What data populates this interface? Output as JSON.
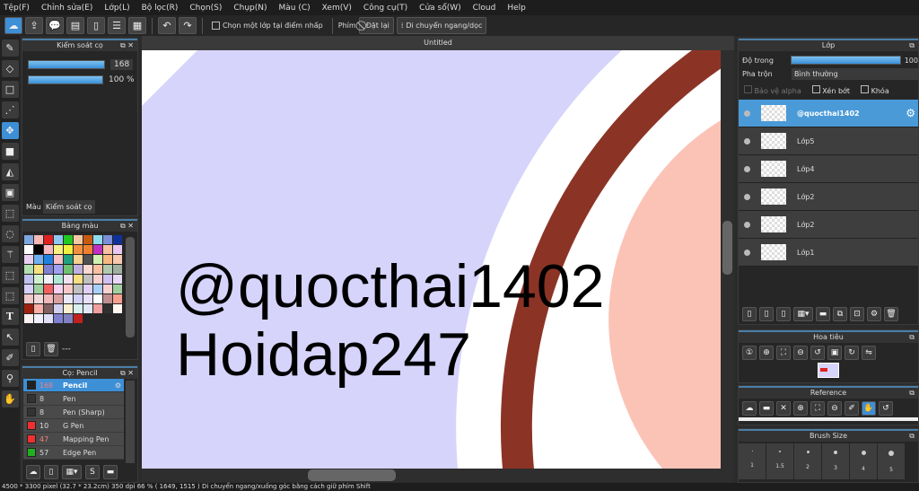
{
  "menu": [
    "Tệp(F)",
    "Chỉnh sửa(E)",
    "Lớp(L)",
    "Bộ lọc(R)",
    "Chọn(S)",
    "Chụp(N)",
    "Màu (C)",
    "Xem(V)",
    "Công cụ(T)",
    "Cửa sổ(W)",
    "Cloud",
    "Help"
  ],
  "toolbar": {
    "select_layer": "Chọn một lớp tại điểm nhấp",
    "key_label": "Phím",
    "reset": "Đặt lại",
    "move": "Di chuyển ngang/dọc"
  },
  "brush_control": {
    "title": "Kiểm soát cọ",
    "size": "168",
    "opacity": "100 %",
    "tab_color": "Màu",
    "tab_brush": "Kiểm soát cọ"
  },
  "palette": {
    "title": "Bảng màu",
    "label": "---",
    "colors": [
      "#7ea6e0",
      "#f7b8b8",
      "#e02020",
      "#8ec8f0",
      "#20c820",
      "#f6c8a8",
      "#c85a10",
      "#8fdcf0",
      "#7c8ed8",
      "#10309a",
      "#ffffff",
      "#000000",
      "#f7b8c0",
      "#f8f080",
      "#f0f040",
      "#f09040",
      "#f08030",
      "#c030c0",
      "#f4c0a0",
      "#e8c8f0",
      "#e8d0f0",
      "#70b0f0",
      "#2080e0",
      "#f8c0c8",
      "#20a080",
      "#f8d090",
      "#505050",
      "#d0f0b0",
      "#f8b880",
      "#f8c8b0",
      "#b0e0b0",
      "#f8e080",
      "#8080d0",
      "#a0a0f0",
      "#70c070",
      "#c0b0e0",
      "#f8d8d0",
      "#f8c0a0",
      "#b0c8b0",
      "#a0b0a0",
      "#c0c0f0",
      "#d0f0d0",
      "#f0f0f8",
      "#b0e8d8",
      "#f0e0f0",
      "#f8e080",
      "#c0c0c0",
      "#f8d0d0",
      "#d0c0f0",
      "#e8d8f8",
      "#d8d0f8",
      "#a0d0a0",
      "#f06060",
      "#f8d0f0",
      "#f8c8c8",
      "#c0c0c0",
      "#e0d0f8",
      "#a8d0f8",
      "#f8d0d0",
      "#a0d0a0",
      "#f0c8c8",
      "#f0d8d8",
      "#f0b8b8",
      "#d8a0a0",
      "#e8e8f8",
      "#d0d0f8",
      "#e8e0f8",
      "#ffffff",
      "#c09090",
      "#f8a090",
      "#a02010",
      "#f8b0a8",
      "#806060",
      "#d0d0f0",
      "#f8f0d0",
      "#d8f0f0",
      "#e0e8f8",
      "#f0a0a0",
      "#303030",
      "#fff8f0",
      "#fff0f0",
      "#f0f0ff",
      "#e0e0f8",
      "#8080d0",
      "#8080c0",
      "#c02020"
    ]
  },
  "brushes": {
    "title": "Cọ: Pencil",
    "items": [
      {
        "size": "168",
        "name": "Pencil",
        "color": "#222222"
      },
      {
        "size": "8",
        "name": "Pen",
        "color": "#333333"
      },
      {
        "size": "8",
        "name": "Pen (Sharp)",
        "color": "#333333"
      },
      {
        "size": "10",
        "name": "G Pen",
        "color": "#f03030"
      },
      {
        "size": "47",
        "name": "Mapping Pen",
        "color": "#f03030"
      },
      {
        "size": "57",
        "name": "Edge Pen",
        "color": "#20b020"
      }
    ]
  },
  "canvas": {
    "tab": "Untitled",
    "text1": "@quocthai1402",
    "text2": "Hoidap247"
  },
  "status": "4500 * 3300 pixel  (32.7 * 23.2cm)  350 dpi  66 %  ( 1649, 1515 )  Di chuyển ngang/xuống góc bằng cách giữ phím Shift",
  "layers": {
    "title": "Lớp",
    "opacity_label": "Độ trong",
    "opacity": "100",
    "blend_label": "Pha trộn",
    "blend": "Bình thường",
    "protect_alpha": "Bảo vệ alpha",
    "clip": "Xén bớt",
    "lock": "Khóa",
    "items": [
      "@quocthai1402",
      "Lớp5",
      "Lớp4",
      "Lớp2",
      "Lớp2",
      "Lớp1"
    ]
  },
  "navigator": {
    "title": "Hoa tiêu"
  },
  "reference": {
    "title": "Reference"
  },
  "brush_size": {
    "title": "Brush Size",
    "sizes": [
      "1",
      "1.5",
      "2",
      "3",
      "4",
      "5"
    ]
  }
}
